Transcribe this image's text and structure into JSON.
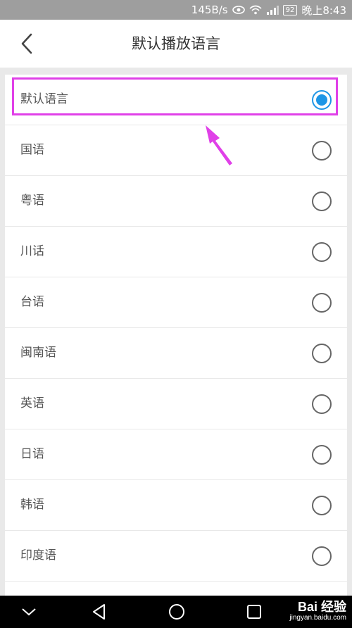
{
  "status_bar": {
    "speed": "145B/s",
    "battery": "92",
    "time": "晚上8:43"
  },
  "header": {
    "title": "默认播放语言"
  },
  "languages": [
    {
      "label": "默认语言",
      "selected": true
    },
    {
      "label": "国语",
      "selected": false
    },
    {
      "label": "粤语",
      "selected": false
    },
    {
      "label": "川话",
      "selected": false
    },
    {
      "label": "台语",
      "selected": false
    },
    {
      "label": "闽南语",
      "selected": false
    },
    {
      "label": "英语",
      "selected": false
    },
    {
      "label": "日语",
      "selected": false
    },
    {
      "label": "韩语",
      "selected": false
    },
    {
      "label": "印度语",
      "selected": false
    }
  ],
  "colors": {
    "accent": "#1e96e6",
    "annotation": "#e040e8"
  },
  "watermark": {
    "main": "Bai 经验",
    "sub": "jingyan.baidu.com"
  }
}
